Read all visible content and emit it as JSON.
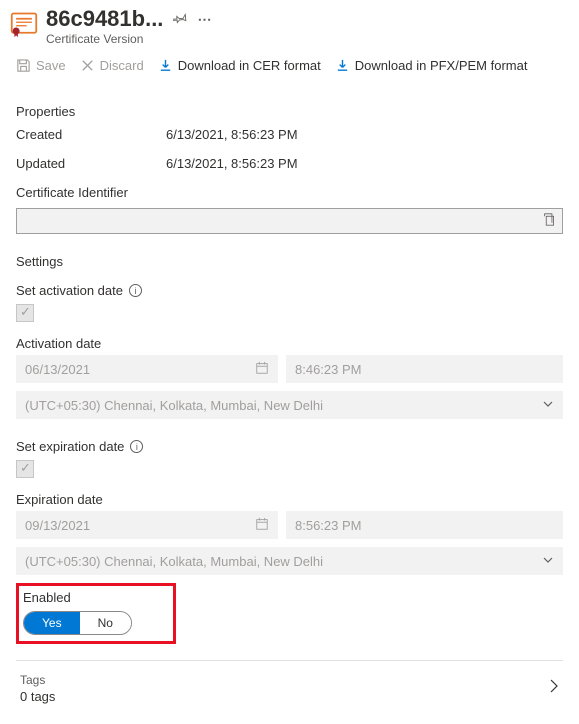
{
  "header": {
    "title": "86c9481b...",
    "subtitle": "Certificate Version"
  },
  "toolbar": {
    "save": "Save",
    "discard": "Discard",
    "download_cer": "Download in CER format",
    "download_pfx": "Download in PFX/PEM format"
  },
  "properties": {
    "title": "Properties",
    "created_label": "Created",
    "created_value": "6/13/2021, 8:56:23 PM",
    "updated_label": "Updated",
    "updated_value": "6/13/2021, 8:56:23 PM",
    "identifier_label": "Certificate Identifier"
  },
  "settings": {
    "title": "Settings",
    "activation_label": "Set activation date",
    "activation_date_label": "Activation date",
    "activation_date": "06/13/2021",
    "activation_time": "8:46:23 PM",
    "activation_tz": "(UTC+05:30) Chennai, Kolkata, Mumbai, New Delhi",
    "expiration_label": "Set expiration date",
    "expiration_date_label": "Expiration date",
    "expiration_date": "09/13/2021",
    "expiration_time": "8:56:23 PM",
    "expiration_tz": "(UTC+05:30) Chennai, Kolkata, Mumbai, New Delhi",
    "enabled_label": "Enabled",
    "enabled_yes": "Yes",
    "enabled_no": "No"
  },
  "tags": {
    "label": "Tags",
    "count": "0 tags"
  }
}
